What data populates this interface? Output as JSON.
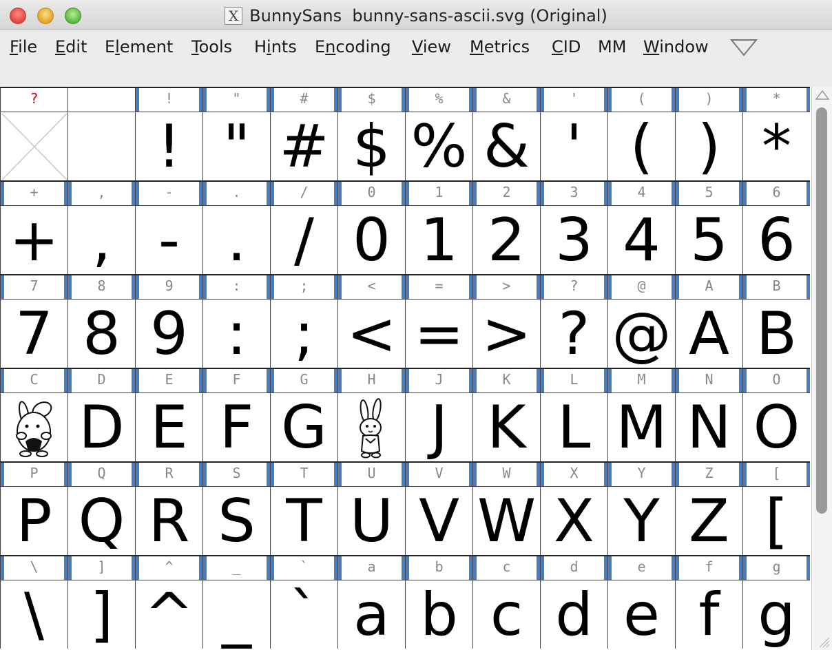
{
  "window": {
    "title": "BunnySans  bunny-sans-ascii.svg (Original)",
    "app_icon_glyph": "X"
  },
  "menu": [
    {
      "label": "File",
      "mnemonic": "F",
      "rest": "ile"
    },
    {
      "label": "Edit",
      "mnemonic": "E",
      "rest": "dit"
    },
    {
      "label": "Element",
      "pre": "E",
      "mnemonic": "l",
      "rest": "ement"
    },
    {
      "label": "Tools",
      "mnemonic": "T",
      "rest": "ools"
    },
    {
      "label": "Hints",
      "pre": "H",
      "mnemonic": "i",
      "rest": "nts"
    },
    {
      "label": "Encoding",
      "pre": "E",
      "mnemonic": "n",
      "rest": "coding"
    },
    {
      "label": "View",
      "mnemonic": "V",
      "rest": "iew"
    },
    {
      "label": "Metrics",
      "mnemonic": "M",
      "rest": "etrics"
    },
    {
      "label": "CID",
      "mnemonic": "C",
      "rest": "ID"
    },
    {
      "label": "MM",
      "pre": "MM",
      "mnemonic": "",
      "rest": ""
    },
    {
      "label": "Window",
      "mnemonic": "W",
      "rest": "indow"
    }
  ],
  "grid_rows": [
    [
      {
        "label": "?",
        "glyph": "",
        "label_color": "red",
        "empty": true,
        "bars": false
      },
      {
        "label": "",
        "glyph": "",
        "bars": false
      },
      {
        "label": "!",
        "glyph": "!"
      },
      {
        "label": "\"",
        "glyph": "\""
      },
      {
        "label": "#",
        "glyph": "#"
      },
      {
        "label": "$",
        "glyph": "$"
      },
      {
        "label": "%",
        "glyph": "%"
      },
      {
        "label": "&",
        "glyph": "&"
      },
      {
        "label": "'",
        "glyph": "'"
      },
      {
        "label": "(",
        "glyph": "("
      },
      {
        "label": ")",
        "glyph": ")"
      },
      {
        "label": "*",
        "glyph": "*"
      }
    ],
    [
      {
        "label": "+",
        "glyph": "+"
      },
      {
        "label": ",",
        "glyph": ","
      },
      {
        "label": "-",
        "glyph": "-"
      },
      {
        "label": ".",
        "glyph": "."
      },
      {
        "label": "/",
        "glyph": "/"
      },
      {
        "label": "0",
        "glyph": "0"
      },
      {
        "label": "1",
        "glyph": "1"
      },
      {
        "label": "2",
        "glyph": "2"
      },
      {
        "label": "3",
        "glyph": "3"
      },
      {
        "label": "4",
        "glyph": "4"
      },
      {
        "label": "5",
        "glyph": "5"
      },
      {
        "label": "6",
        "glyph": "6"
      }
    ],
    [
      {
        "label": "7",
        "glyph": "7"
      },
      {
        "label": "8",
        "glyph": "8"
      },
      {
        "label": "9",
        "glyph": "9"
      },
      {
        "label": ":",
        "glyph": ":"
      },
      {
        "label": ";",
        "glyph": ";"
      },
      {
        "label": "<",
        "glyph": "<"
      },
      {
        "label": "=",
        "glyph": "="
      },
      {
        "label": ">",
        "glyph": ">"
      },
      {
        "label": "?",
        "glyph": "?"
      },
      {
        "label": "@",
        "glyph": "@"
      },
      {
        "label": "A",
        "glyph": "A"
      },
      {
        "label": "B",
        "glyph": "B"
      }
    ],
    [
      {
        "label": "C",
        "glyph": "",
        "bunny": "bunny-eating-icon"
      },
      {
        "label": "D",
        "glyph": "D"
      },
      {
        "label": "E",
        "glyph": "E"
      },
      {
        "label": "F",
        "glyph": "F"
      },
      {
        "label": "G",
        "glyph": "G"
      },
      {
        "label": "H",
        "glyph": "",
        "bunny": "bunny-standing-icon"
      },
      {
        "label": "J",
        "glyph": "J"
      },
      {
        "label": "K",
        "glyph": "K"
      },
      {
        "label": "L",
        "glyph": "L"
      },
      {
        "label": "M",
        "glyph": "M"
      },
      {
        "label": "N",
        "glyph": "N"
      },
      {
        "label": "O",
        "glyph": "O"
      }
    ],
    [
      {
        "label": "P",
        "glyph": "P"
      },
      {
        "label": "Q",
        "glyph": "Q"
      },
      {
        "label": "R",
        "glyph": "R"
      },
      {
        "label": "S",
        "glyph": "S"
      },
      {
        "label": "T",
        "glyph": "T"
      },
      {
        "label": "U",
        "glyph": "U"
      },
      {
        "label": "V",
        "glyph": "V"
      },
      {
        "label": "W",
        "glyph": "W"
      },
      {
        "label": "X",
        "glyph": "X"
      },
      {
        "label": "Y",
        "glyph": "Y"
      },
      {
        "label": "Z",
        "glyph": "Z"
      },
      {
        "label": "[",
        "glyph": "["
      }
    ],
    [
      {
        "label": "\\",
        "glyph": "\\"
      },
      {
        "label": "]",
        "glyph": "]"
      },
      {
        "label": "^",
        "glyph": "^"
      },
      {
        "label": "_",
        "glyph": "_"
      },
      {
        "label": "`",
        "glyph": "`"
      },
      {
        "label": "a",
        "glyph": "a"
      },
      {
        "label": "b",
        "glyph": "b"
      },
      {
        "label": "c",
        "glyph": "c"
      },
      {
        "label": "d",
        "glyph": "d"
      },
      {
        "label": "e",
        "glyph": "e"
      },
      {
        "label": "f",
        "glyph": "f"
      },
      {
        "label": "g",
        "glyph": "g"
      }
    ]
  ],
  "colors": {
    "worth_outline_bar": "#4a7dc0",
    "missing_label": "#e00000",
    "grid_line": "#444444"
  },
  "icons": {
    "menu_overflow": "triangle-down-icon",
    "scroll_up": "triangle-up-icon",
    "empty_glyph": "cross-box-icon"
  }
}
